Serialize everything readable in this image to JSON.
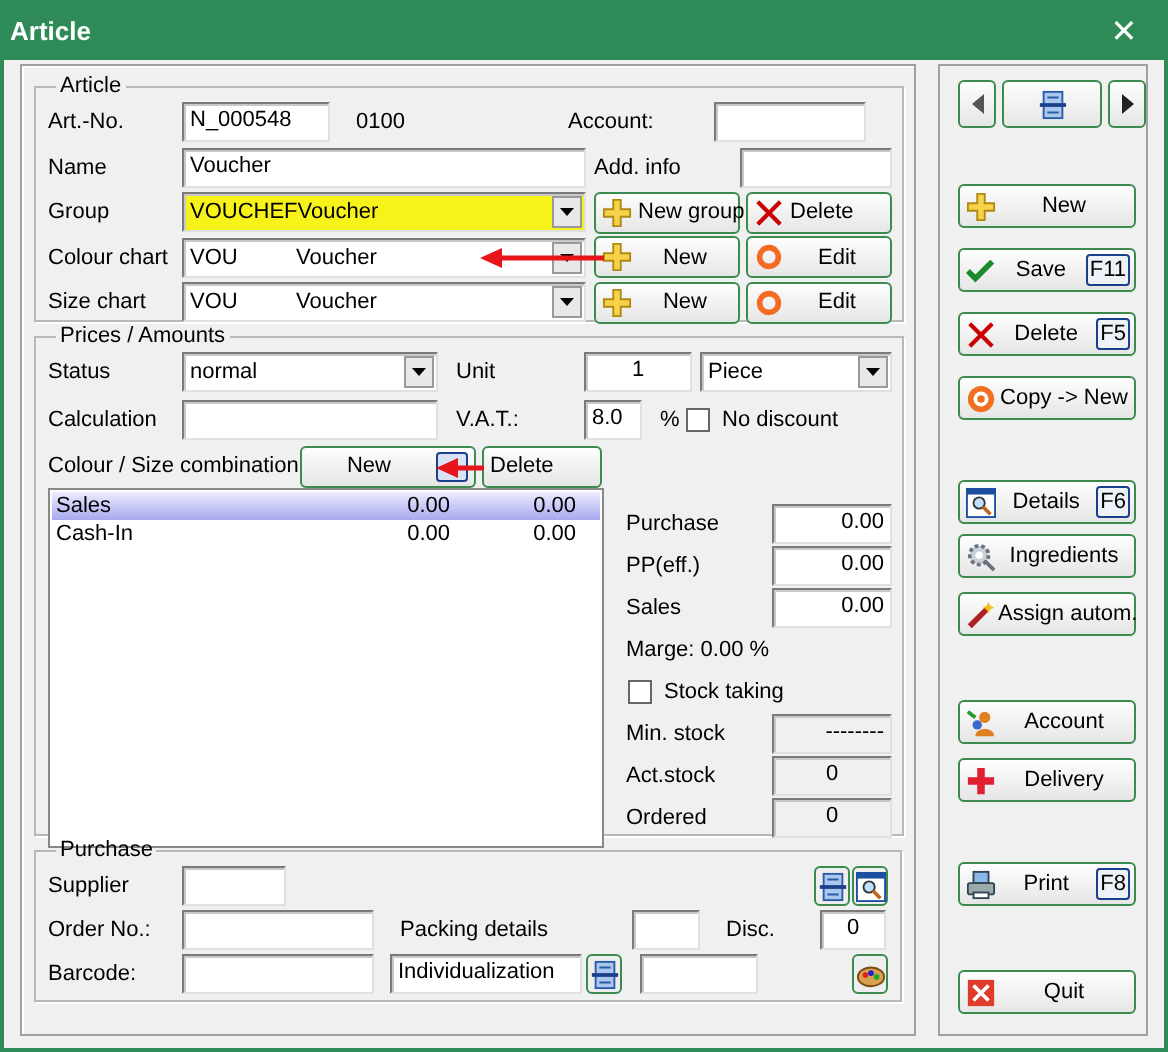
{
  "window": {
    "title": "Article",
    "close": "✕"
  },
  "article": {
    "legend": "Article",
    "art_no": {
      "label": "Art.-No.",
      "value": "N_000548",
      "code": "0100"
    },
    "account": {
      "label": "Account:"
    },
    "name": {
      "label": "Name",
      "value": "Voucher"
    },
    "add_info": {
      "label": "Add. info"
    },
    "group": {
      "label": "Group",
      "value": "VOUCHEFVoucher",
      "highlighted": true,
      "buttons": [
        "New group",
        "Delete"
      ]
    },
    "charts": [
      {
        "label": "Colour chart",
        "code": "VOU",
        "value": "Voucher",
        "buttons": [
          "New",
          "Edit"
        ]
      },
      {
        "label": "Size chart",
        "code": "VOU",
        "value": "Voucher",
        "buttons": [
          "New",
          "Edit"
        ]
      }
    ]
  },
  "prices": {
    "legend": "Prices / Amounts",
    "status": {
      "label": "Status",
      "value": "normal"
    },
    "unit": {
      "label": "Unit",
      "value": "1",
      "unit": "Piece"
    },
    "calculation": {
      "label": "Calculation"
    },
    "vat": {
      "label": "V.A.T.:",
      "value": "8.0",
      "suffix": "%"
    },
    "no_discount": {
      "label": "No discount",
      "checked": false
    },
    "combination": {
      "label": "Colour / Size combination",
      "buttons": [
        "New",
        "Delete"
      ],
      "rows": [
        {
          "name": "Sales",
          "column_2": "0.00",
          "column_3": "0.00",
          "selected": true
        },
        {
          "name": "Cash-In",
          "column_2": "0.00",
          "column_3": "0.00",
          "selected": false
        }
      ]
    },
    "amounts": [
      {
        "label": "Purchase",
        "value": "0.00"
      },
      {
        "label": "PP(eff.)",
        "value": "0.00"
      },
      {
        "label": "Sales",
        "value": "0.00"
      }
    ],
    "marge": "Marge: 0.00 %",
    "stock_taking": {
      "label": "Stock taking",
      "checked": false
    },
    "stock": [
      {
        "label": "Min. stock",
        "value": "--------",
        "disabled": true
      },
      {
        "label": "Act.stock",
        "value": "0",
        "disabled": true
      },
      {
        "label": "Ordered",
        "value": "0",
        "disabled": true
      }
    ]
  },
  "purchase": {
    "legend": "Purchase",
    "supplier": {
      "label": "Supplier"
    },
    "order_no": {
      "label": "Order No.:"
    },
    "packing": {
      "label": "Packing details"
    },
    "disc": {
      "label": "Disc.",
      "value": "0"
    },
    "barcode": {
      "label": "Barcode:"
    },
    "individualization": {
      "value": "Individualization"
    }
  },
  "actions": [
    {
      "label": "New"
    },
    {
      "label": "Save",
      "key": "F11"
    },
    {
      "label": "Delete",
      "key": "F5"
    },
    {
      "label": "Copy -> New"
    },
    {
      "label": "Details",
      "key": "F6"
    },
    {
      "label": "Ingredients"
    },
    {
      "label": "Assign autom."
    },
    {
      "label": "Account"
    },
    {
      "label": "Delivery"
    },
    {
      "label": "Print",
      "key": "F8"
    },
    {
      "label": "Quit"
    }
  ]
}
